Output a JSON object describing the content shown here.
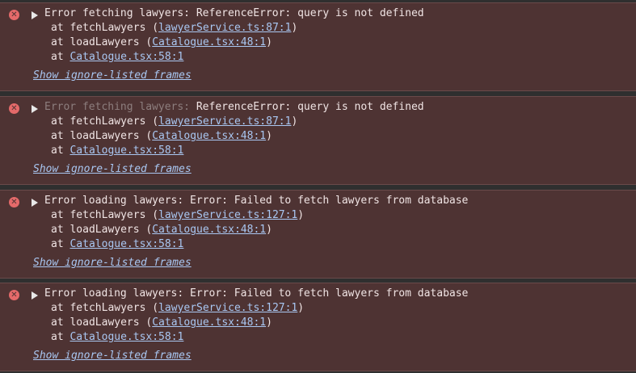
{
  "entries": [
    {
      "prefix": "Error fetching lawyers: ",
      "prefix_dim": false,
      "message": "ReferenceError: query is not defined",
      "frames": [
        {
          "at": "at ",
          "func": "fetchLawyers",
          "open": " (",
          "link": "lawyerService.ts:87:1",
          "close": ")"
        },
        {
          "at": "at ",
          "func": "loadLawyers",
          "open": " (",
          "link": "Catalogue.tsx:48:1",
          "close": ")"
        },
        {
          "at": "at ",
          "func": "",
          "open": "",
          "link": "Catalogue.tsx:58:1",
          "close": ""
        }
      ],
      "show_ignored": "Show ignore-listed frames"
    },
    {
      "prefix": "Error fetching lawyers: ",
      "prefix_dim": true,
      "message": "ReferenceError: query is not defined",
      "frames": [
        {
          "at": "at ",
          "func": "fetchLawyers",
          "open": " (",
          "link": "lawyerService.ts:87:1",
          "close": ")"
        },
        {
          "at": "at ",
          "func": "loadLawyers",
          "open": " (",
          "link": "Catalogue.tsx:48:1",
          "close": ")"
        },
        {
          "at": "at ",
          "func": "",
          "open": "",
          "link": "Catalogue.tsx:58:1",
          "close": ""
        }
      ],
      "show_ignored": "Show ignore-listed frames"
    },
    {
      "prefix": "Error loading lawyers: ",
      "prefix_dim": false,
      "message": "Error: Failed to fetch lawyers from database",
      "frames": [
        {
          "at": "at ",
          "func": "fetchLawyers",
          "open": " (",
          "link": "lawyerService.ts:127:1",
          "close": ")"
        },
        {
          "at": "at ",
          "func": "loadLawyers",
          "open": " (",
          "link": "Catalogue.tsx:48:1",
          "close": ")"
        },
        {
          "at": "at ",
          "func": "",
          "open": "",
          "link": "Catalogue.tsx:58:1",
          "close": ""
        }
      ],
      "show_ignored": "Show ignore-listed frames"
    },
    {
      "prefix": "Error loading lawyers: ",
      "prefix_dim": false,
      "message": "Error: Failed to fetch lawyers from database",
      "frames": [
        {
          "at": "at ",
          "func": "fetchLawyers",
          "open": " (",
          "link": "lawyerService.ts:127:1",
          "close": ")"
        },
        {
          "at": "at ",
          "func": "loadLawyers",
          "open": " (",
          "link": "Catalogue.tsx:48:1",
          "close": ")"
        },
        {
          "at": "at ",
          "func": "",
          "open": "",
          "link": "Catalogue.tsx:58:1",
          "close": ""
        }
      ],
      "show_ignored": "Show ignore-listed frames"
    }
  ],
  "icons": {
    "error": "error-icon",
    "expand": "expand-triangle-icon"
  },
  "colors": {
    "entry_background": "#4e3333",
    "text": "#f0e4e4",
    "link": "#a9c7f2",
    "error_icon": "#e46a6a",
    "dim_prefix": "#8d7e7e"
  }
}
